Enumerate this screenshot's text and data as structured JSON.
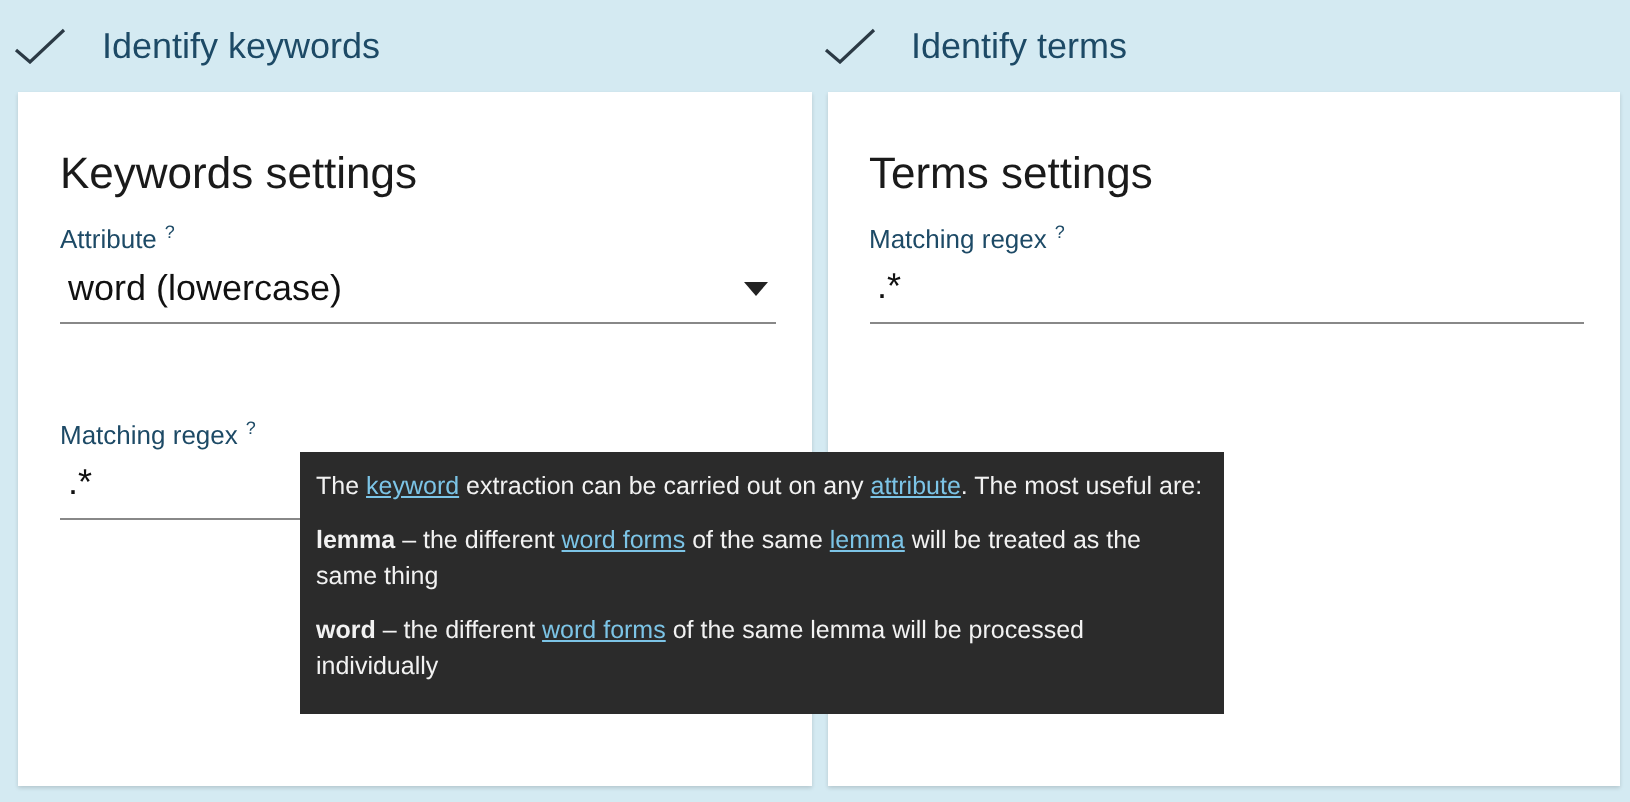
{
  "panels": [
    {
      "header": {
        "title": "Identify keywords",
        "checked": true
      },
      "card": {
        "title": "Keywords settings",
        "fields": [
          {
            "kind": "select",
            "label": "Attribute",
            "help": "?",
            "value": "word (lowercase)"
          },
          {
            "kind": "text",
            "label": "Matching regex",
            "help": "?",
            "value": ".*"
          }
        ]
      }
    },
    {
      "header": {
        "title": "Identify terms",
        "checked": true
      },
      "card": {
        "title": "Terms settings",
        "fields": [
          {
            "kind": "text",
            "label": "Matching regex",
            "help": "?",
            "value": ".*"
          }
        ]
      }
    }
  ],
  "tooltip": {
    "paragraphs": [
      [
        {
          "kind": "text",
          "text": "The "
        },
        {
          "kind": "link",
          "text": "keyword"
        },
        {
          "kind": "text",
          "text": " extraction can be carried out on any "
        },
        {
          "kind": "link",
          "text": "attribute"
        },
        {
          "kind": "text",
          "text": ". The most useful are:"
        }
      ],
      [
        {
          "kind": "bold",
          "text": "lemma"
        },
        {
          "kind": "text",
          "text": " – the different "
        },
        {
          "kind": "link",
          "text": "word forms"
        },
        {
          "kind": "text",
          "text": " of the same "
        },
        {
          "kind": "link",
          "text": "lemma"
        },
        {
          "kind": "text",
          "text": " will be treated as the same thing"
        }
      ],
      [
        {
          "kind": "bold",
          "text": "word"
        },
        {
          "kind": "text",
          "text": " – the different "
        },
        {
          "kind": "link",
          "text": "word forms"
        },
        {
          "kind": "text",
          "text": " of the same lemma will be processed individually"
        }
      ]
    ]
  }
}
